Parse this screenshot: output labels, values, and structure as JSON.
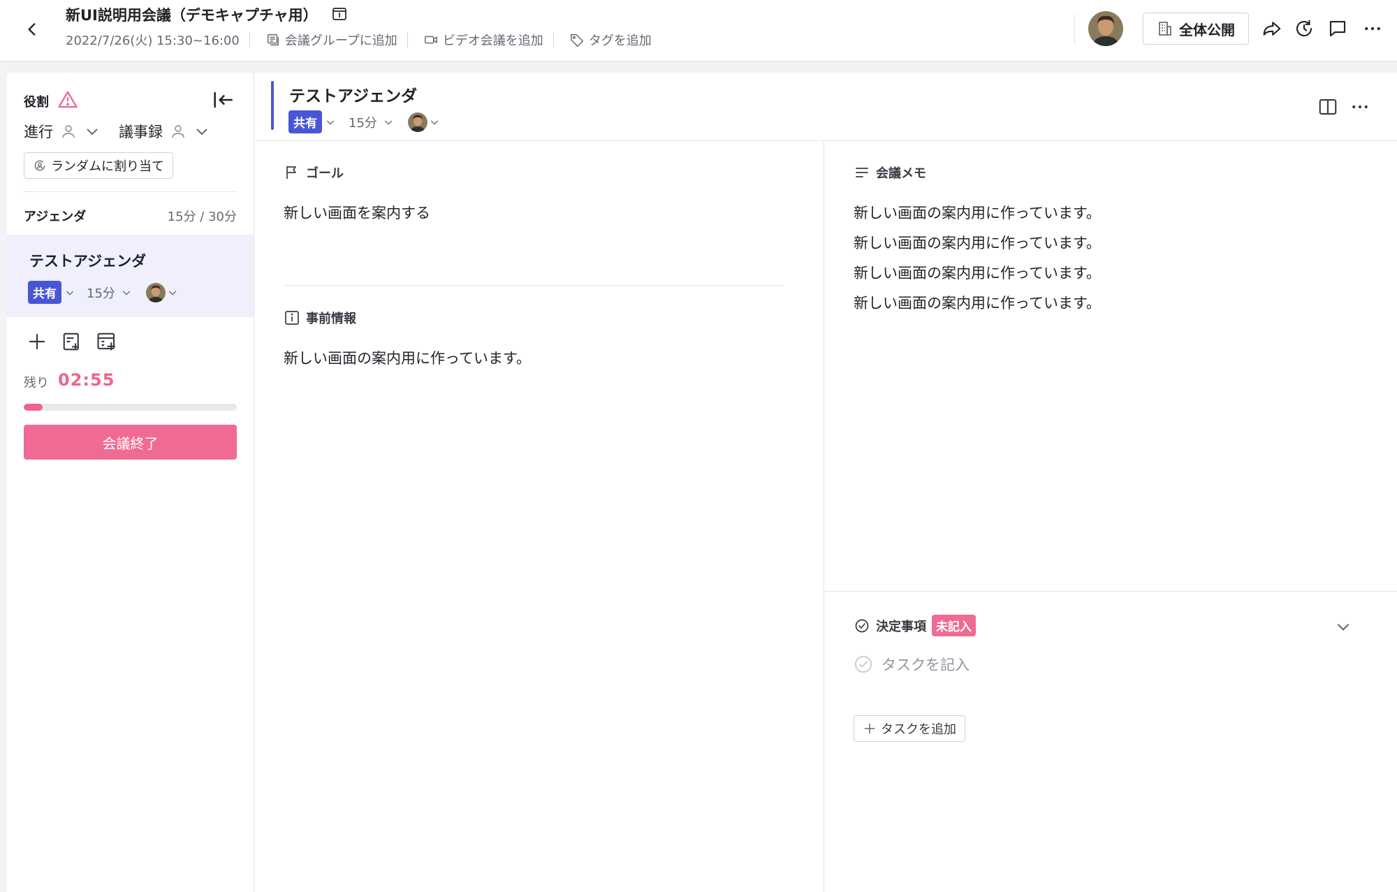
{
  "header": {
    "title": "新UI説明用会議（デモキャプチャ用）",
    "datetime": "2022/7/26(火) 15:30~16:00",
    "add_group": "会議グループに追加",
    "add_video": "ビデオ会議を追加",
    "add_tag": "タグを追加",
    "visibility": "全体公開"
  },
  "sidebar": {
    "roles_title": "役割",
    "facilitator": "進行",
    "minutes": "議事録",
    "random_assign": "ランダムに割り当て",
    "agenda_title": "アジェンダ",
    "agenda_duration": "15分 / 30分",
    "agenda_item": {
      "name": "テストアジェンダ",
      "share": "共有",
      "duration": "15分"
    },
    "remaining_label": "残り",
    "remaining_time": "02:55",
    "progress_fraction": 0.09,
    "end_button": "会議終了"
  },
  "main": {
    "agenda_title": "テストアジェンダ",
    "share": "共有",
    "duration": "15分",
    "goal_title": "ゴール",
    "goal_text": "新しい画面を案内する",
    "preinfo_title": "事前情報",
    "preinfo_text": "新しい画面の案内用に作っています。",
    "memo_title": "会議メモ",
    "memo_lines": [
      "新しい画面の案内用に作っています。",
      "新しい画面の案内用に作っています。",
      "新しい画面の案内用に作っています。",
      "新しい画面の案内用に作っています。"
    ],
    "decision_title": "決定事項",
    "decision_badge": "未記入",
    "task_placeholder": "タスクを記入",
    "add_task": "タスクを追加"
  },
  "colors": {
    "accent": "#4856d6",
    "pink": "#f06b93",
    "agenda_bg": "#eff0fb"
  }
}
